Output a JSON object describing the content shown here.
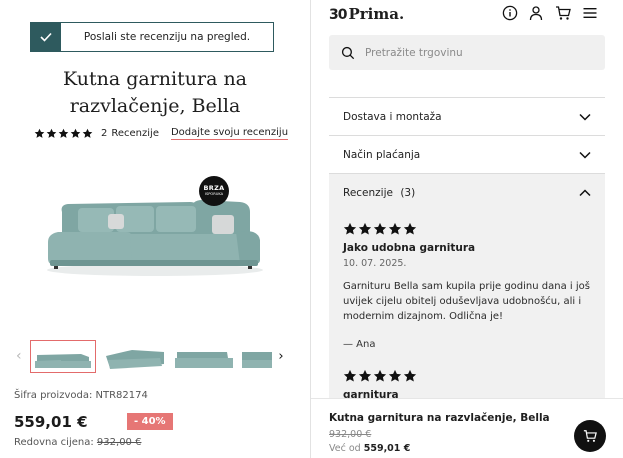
{
  "toast": {
    "message": "Poslali ste recenziju na pregled."
  },
  "product": {
    "title_line1": "Kutna garnitura na",
    "title_line2": "razvlačenje, Bella",
    "review_count": "2",
    "review_label": "Recenzije",
    "add_review": "Dodajte svoju recenziju",
    "rating": 5,
    "badge_line1": "BRZA",
    "badge_line2": "ISPORUKA",
    "sku": "Šifra proizvoda: NTR82174",
    "price": "559,01 €",
    "discount": "- 40%",
    "regular_label": "Redovna cijena:",
    "regular_price": "932,00 €",
    "thumbnail_prev": "‹",
    "thumbnail_next": "›"
  },
  "header": {
    "logo_number": "30",
    "logo_name": "Prima.",
    "icons": [
      "info-icon",
      "user-icon",
      "cart-icon",
      "menu-icon"
    ]
  },
  "search": {
    "placeholder": "Pretražite trgovinu"
  },
  "accordion": {
    "delivery": "Dostava i montaža",
    "payment": "Način plaćanja",
    "reviews": "Recenzije",
    "reviews_count": "(3)"
  },
  "reviews": [
    {
      "rating": 5,
      "title": "Jako udobna garnitura",
      "date": "10. 07. 2025.",
      "body": "Garnituru Bella sam kupila prije godinu dana i još uvijek cijelu obitelj oduševljava udobnošću, ali i modernim dizajnom. Odlična je!",
      "author": "— Ana"
    },
    {
      "rating": 5,
      "title": "garnitura"
    }
  ],
  "sticky": {
    "name": "Kutna garnitura na razvlačenje, Bella",
    "old_price": "932,00 €",
    "from_label": "Već od",
    "price": "559,01 €"
  },
  "colors": {
    "brand_teal": "#2e5a5e",
    "accent_red": "#e26d6d",
    "sofa": "#8fb3b0",
    "dark": "#111111"
  }
}
